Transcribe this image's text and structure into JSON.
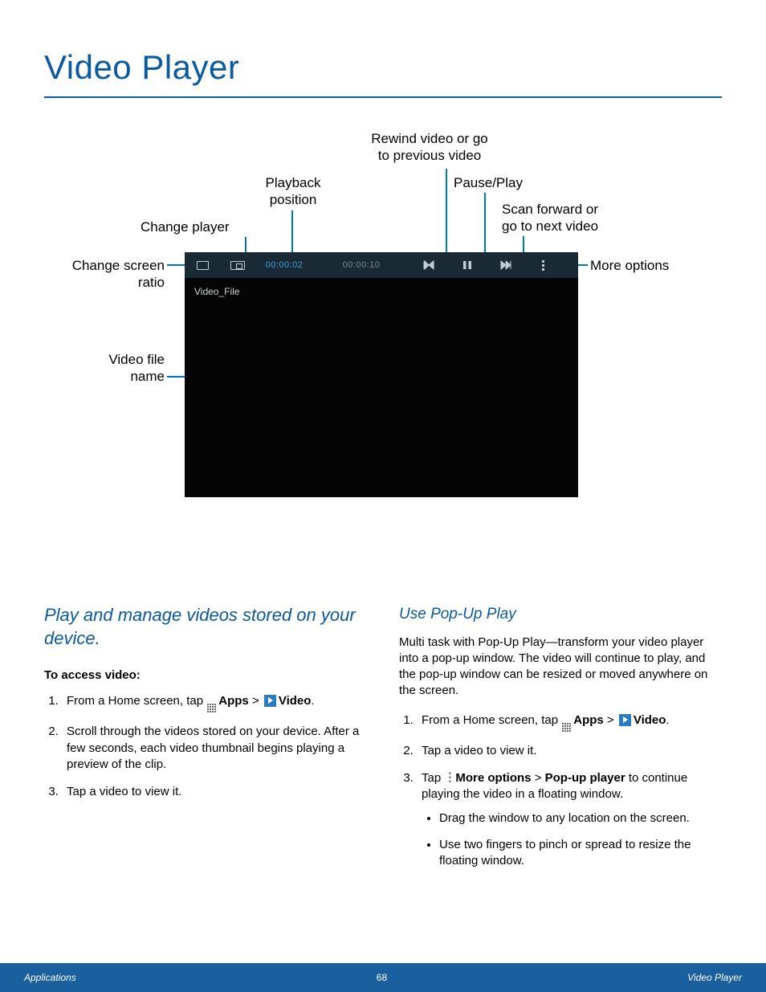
{
  "title": "Video Player",
  "callouts": {
    "rewind": "Rewind video or go\nto previous video",
    "playback": "Playback\nposition",
    "pauseplay": "Pause/Play",
    "changeplayer": "Change player",
    "scanfwd": "Scan forward or\ngo to next video",
    "changeratio": "Change screen\nratio",
    "moreopts": "More options",
    "filename": "Video file\nname"
  },
  "player": {
    "time_current": "00:00:02",
    "time_total": "00:00:10",
    "file_name": "Video_File"
  },
  "left": {
    "intro": "Play and manage videos stored on your device.",
    "lead": "To access video:",
    "step1_a": "From a Home screen, tap ",
    "apps": "Apps",
    "gt": " > ",
    "video": "Video",
    "step2": "Scroll through the videos stored on your device. After a few seconds, each video thumbnail begins playing a preview of the clip.",
    "step3": "Tap a video to view it."
  },
  "right": {
    "heading": "Use Pop-Up Play",
    "para": "Multi task with Pop-Up Play—transform your video player into a pop-up window. The video will continue to play, and the pop-up window can be resized or moved anywhere on the screen.",
    "step1_a": "From a Home screen, tap ",
    "apps": "Apps",
    "gt": " > ",
    "video": "Video",
    "step2": "Tap a video to view it.",
    "step3_a": "Tap ",
    "moreopts": "More options",
    "step3_b": " > ",
    "popup": "Pop-up player",
    "step3_c": " to continue playing the video in a floating window.",
    "bullet1": "Drag the window to any location on the screen.",
    "bullet2": "Use two fingers to pinch or spread to resize the floating window."
  },
  "footer": {
    "left": "Applications",
    "page": "68",
    "right": "Video Player"
  }
}
